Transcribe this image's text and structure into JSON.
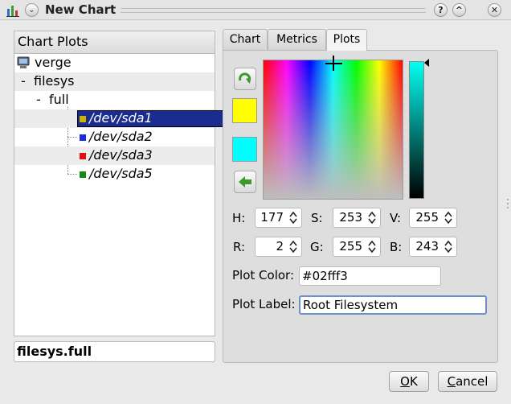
{
  "window": {
    "title": "New Chart",
    "help_label": "?",
    "menu_label": "⌄",
    "collapse_label": "^",
    "close_label": "✕"
  },
  "left_panel": {
    "header": "Chart Plots",
    "tree": [
      {
        "label": "verge",
        "expander": "",
        "icon": "computer-icon"
      },
      {
        "label": "filesys",
        "expander": "-"
      },
      {
        "label": "full",
        "expander": "-"
      },
      {
        "label": "/dev/sda1",
        "color": "#c8b400",
        "selected": true
      },
      {
        "label": "/dev/sda2",
        "color": "#1a2ce0"
      },
      {
        "label": "/dev/sda3",
        "color": "#e01010"
      },
      {
        "label": "/dev/sda5",
        "color": "#148a14"
      }
    ],
    "name_field_value": "filesys.full"
  },
  "tabs": [
    {
      "label": "Chart",
      "active": false
    },
    {
      "label": "Metrics",
      "active": false
    },
    {
      "label": "Plots",
      "active": true
    }
  ],
  "plots": {
    "old_color": "#ffff00",
    "new_color": "#00ffff",
    "h_label": "H:",
    "h_value": "177",
    "s_label": "S:",
    "s_value": "253",
    "v_label": "V:",
    "v_value": "255",
    "r_label": "R:",
    "r_value": "2",
    "g_label": "G:",
    "g_value": "255",
    "b_label": "B:",
    "b_value": "243",
    "plot_color_label": "Plot Color:",
    "plot_color_value": "#02fff3",
    "plot_label_label": "Plot Label:",
    "plot_label_value": "Root Filesystem"
  },
  "buttons": {
    "ok_label": "OK",
    "cancel_label": "Cancel"
  }
}
